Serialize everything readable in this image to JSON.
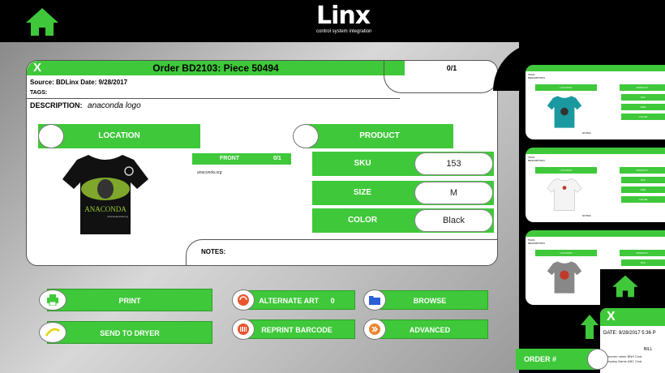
{
  "header": {
    "logo_word": "Linx",
    "logo_tagline": "control system integration"
  },
  "order": {
    "close_label": "X",
    "title": "Order BD2103: Piece 50494",
    "count": "0/1",
    "source_line": "Source: BDLinx  Date: 9/28/2017",
    "tags_label": "TAGS:",
    "description_label": "DESCRIPTION:",
    "description_value": "anaconda logo",
    "location_label": "LOCATION",
    "product_label": "PRODUCT",
    "front_label": "FRONT",
    "front_count": "0/1",
    "front_url": "anaconda.org",
    "shirt_art_text": "ANACONDA",
    "shirt_art_url": "www.anaconda.org",
    "attributes": [
      {
        "label": "SKU",
        "value": "153"
      },
      {
        "label": "SIZE",
        "value": "M"
      },
      {
        "label": "COLOR",
        "value": "Black"
      }
    ],
    "notes_label": "NOTES:"
  },
  "actions": {
    "print": "PRINT",
    "send_to_dryer": "SEND TO DRYER",
    "alternate_art": "ALTERNATE ART",
    "alternate_art_count": "0",
    "reprint_barcode": "REPRINT BARCODE",
    "browse": "BROWSE",
    "advanced": "ADVANCED"
  },
  "side_panel": {
    "mini_tags": "TAGS:",
    "mini_description": "DESCRIPTION:",
    "mini_location": "LOCATION",
    "mini_product": "PRODUCT",
    "mini_sku": "SKU",
    "mini_size": "SIZE",
    "mini_color": "COLOR",
    "mini_notes": "NOTES:",
    "overlay_close": "X",
    "overlay_date": "DATE:  9/28/2017 5:36 P",
    "overlay_bill": "BILL",
    "overlay_customer": "Customer name  BNH Cust",
    "overlay_company": "Company Name  ABC Cust",
    "order_number_label": "ORDER #"
  },
  "colors": {
    "accent_green": "#3fc83a",
    "background": "#000000"
  }
}
